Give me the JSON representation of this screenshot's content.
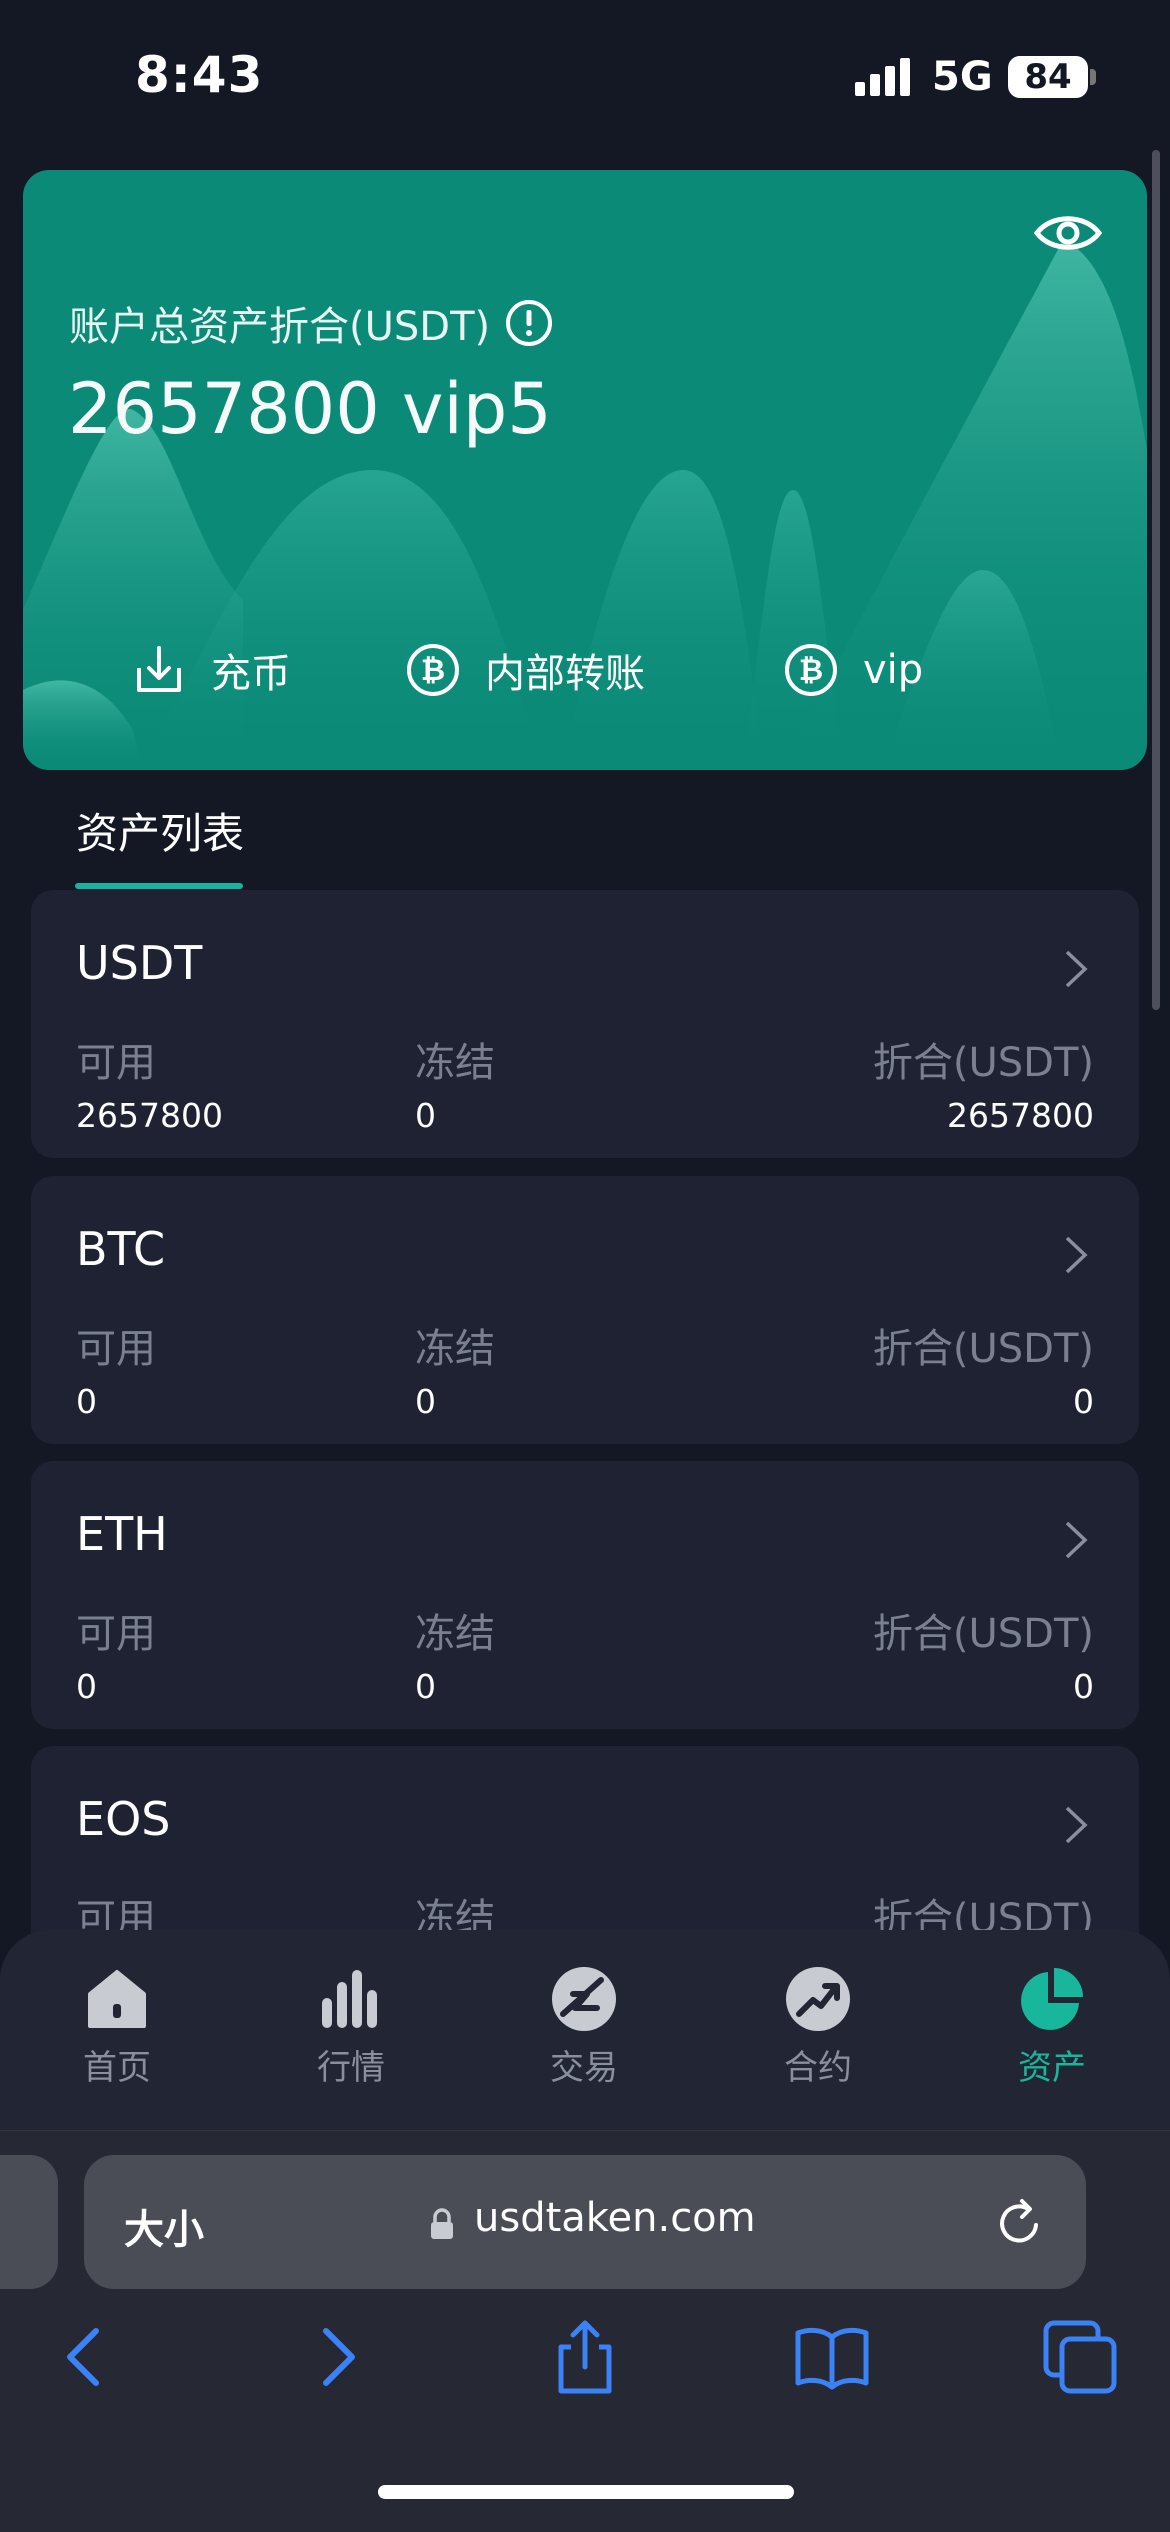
{
  "status_bar": {
    "time": "8:43",
    "network": "5G",
    "battery": "84"
  },
  "asset_card": {
    "total_label": "账户总资产折合(USDT)",
    "total_value": "2657800 vip5",
    "actions": {
      "deposit": "充币",
      "transfer": "内部转账",
      "vip": "vip"
    }
  },
  "list_tab": "资产列表",
  "columns": {
    "available": "可用",
    "frozen": "冻结",
    "converted": "折合(USDT)"
  },
  "assets": [
    {
      "name": "USDT",
      "available": "2657800",
      "frozen": "0",
      "converted": "2657800"
    },
    {
      "name": "BTC",
      "available": "0",
      "frozen": "0",
      "converted": "0"
    },
    {
      "name": "ETH",
      "available": "0",
      "frozen": "0",
      "converted": "0"
    },
    {
      "name": "EOS",
      "available": "",
      "frozen": "",
      "converted": ""
    }
  ],
  "tab_bar": {
    "items": [
      {
        "label": "首页",
        "icon": "home-icon"
      },
      {
        "label": "行情",
        "icon": "bar-chart-icon"
      },
      {
        "label": "交易",
        "icon": "trade-icon"
      },
      {
        "label": "合约",
        "icon": "trend-icon"
      },
      {
        "label": "资产",
        "icon": "pie-chart-icon",
        "active": true
      }
    ]
  },
  "browser": {
    "text_size_label": "大小",
    "url": "usdtaken.com"
  },
  "colors": {
    "accent": "#18b69b",
    "card": "#0b8a78",
    "background": "#141824",
    "row": "#1e2232"
  }
}
